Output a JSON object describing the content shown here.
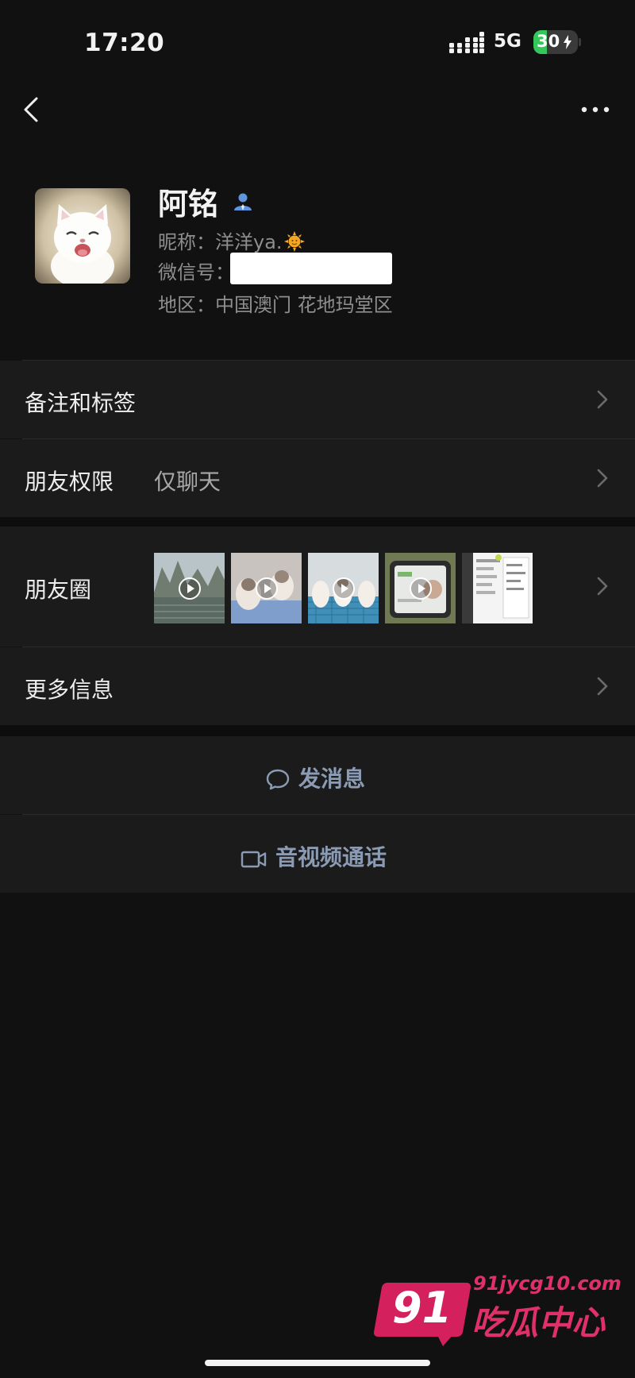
{
  "status_bar": {
    "time": "17:20",
    "network": "5G",
    "battery": "30",
    "battery_level": 0.3
  },
  "nav": {
    "back_icon": "chevron-left-icon",
    "more_icon": "more-dots-icon"
  },
  "profile": {
    "name": "阿铭",
    "nickname": "昵称：洋洋ya.",
    "wechat_id_label": "微信号：",
    "region": "地区：中国澳门 花地玛堂区"
  },
  "rows": {
    "remarks_label": "备注和标签",
    "permission_label": "朋友权限",
    "permission_value": "仅聊天",
    "moments_label": "朋友圈",
    "more_info_label": "更多信息"
  },
  "actions": {
    "message_label": "发消息",
    "call_label": "音视频通话"
  },
  "watermark": {
    "logo_number": "91",
    "url": "91jycg10.com",
    "brand": "吃瓜中心"
  },
  "colors": {
    "background": "#111111",
    "row_background": "#1b1b1b",
    "action_text": "#8c9bb4",
    "battery_green": "#34c759",
    "watermark_pink": "#d4215d"
  }
}
